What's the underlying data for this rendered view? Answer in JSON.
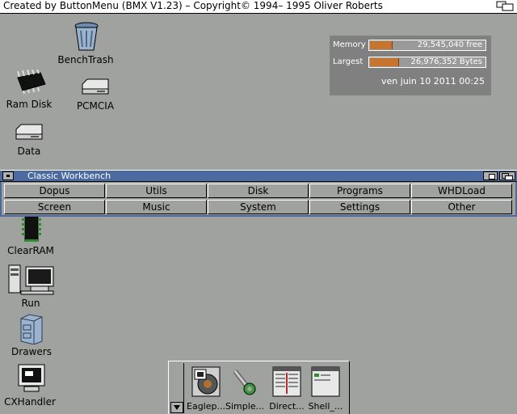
{
  "screen_title": "Created by ButtonMenu (BMX V1.23) – Copyright© 1994– 1995 Oliver Roberts",
  "desktop_icons": {
    "benchtrash": "BenchTrash",
    "ramdisk": "Ram Disk",
    "pcmcia": "PCMCIA",
    "data": "Data",
    "clearram": "ClearRAM",
    "run": "Run",
    "drawers": "Drawers",
    "cxhandler": "CXHandler"
  },
  "memory": {
    "memory_label": "Memory",
    "memory_value": "29,545,040 free",
    "memory_fill": 0.19,
    "largest_label": "Largest",
    "largest_value": "26,976,352 Bytes",
    "largest_fill": 0.24,
    "datetime": "ven juin 10 2011 00:25",
    "fill_color": "#c7742f"
  },
  "window": {
    "title": "Classic Workbench",
    "title_color": "#4a6aa0",
    "row1": [
      "Dopus",
      "Utils",
      "Disk",
      "Programs",
      "WHDLoad"
    ],
    "row2": [
      "Screen",
      "Music",
      "System",
      "Settings",
      "Other"
    ]
  },
  "dock": {
    "items": [
      "Eaglep...",
      "Simple...",
      "Direct...",
      "Shell_..."
    ]
  }
}
